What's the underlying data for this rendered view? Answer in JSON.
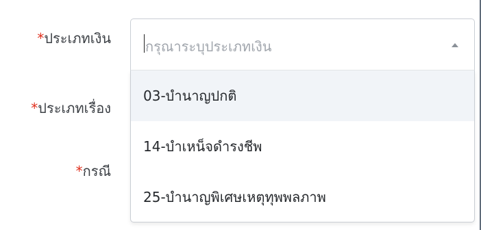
{
  "form": {
    "fields": [
      {
        "required_mark": "*",
        "label": "ประเภทเงิน"
      },
      {
        "required_mark": "*",
        "label": "ประเภทเรื่อง"
      },
      {
        "required_mark": "*",
        "label": "กรณี"
      }
    ],
    "money_type_select": {
      "placeholder": "กรุณาระบุประเภทเงิน",
      "options": [
        {
          "label": "03-บำนาญปกติ",
          "highlighted": true
        },
        {
          "label": "14-บำเหน็จดำรงชีพ",
          "highlighted": false
        },
        {
          "label": "25-บำนาญพิเศษเหตุทุพพลภาพ",
          "highlighted": false
        }
      ]
    }
  },
  "colors": {
    "required": "#e0301e",
    "highlight_bg": "#f1f4f8",
    "border": "#c9ced4"
  },
  "icons": {
    "select_toggle": "caret-up-icon"
  }
}
